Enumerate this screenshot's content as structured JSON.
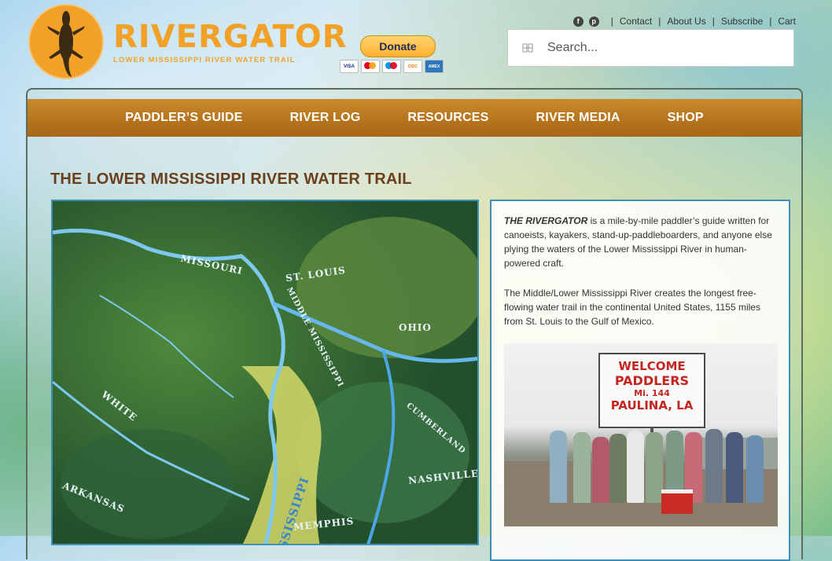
{
  "brand": {
    "name": "RIVERGATOR",
    "tagline": "LOWER MISSISSIPPI RIVER WATER TRAIL",
    "accent": "#f2a128"
  },
  "donate": {
    "label": "Donate",
    "cards": [
      "VISA",
      "MC",
      "MAESTRO",
      "DISCOVER",
      "AMEX"
    ]
  },
  "top_links": {
    "social": [
      "facebook-icon",
      "pinterest-icon"
    ],
    "items": [
      "Contact",
      "About Us",
      "Subscribe",
      "Cart"
    ]
  },
  "search": {
    "placeholder": "Search..."
  },
  "nav": {
    "items": [
      "PADDLER’S GUIDE",
      "RIVER LOG",
      "RESOURCES",
      "RIVER MEDIA",
      "SHOP"
    ],
    "color": "#b5731c"
  },
  "page": {
    "title": "THE LOWER MISSISSIPPI RIVER WATER TRAIL",
    "title_color": "#6b3f1c"
  },
  "map": {
    "labels": [
      "MISSOURI",
      "ST. LOUIS",
      "MIDDLE MISSISSIPPI",
      "OHIO",
      "CUMBERLAND",
      "NASHVILLE",
      "WHITE",
      "ARKANSAS",
      "MISSISSIPPI",
      "MEMPHIS"
    ]
  },
  "intro": {
    "lead": "THE RIVERGATOR",
    "para1": " is a mile-by-mile paddler’s guide written for canoeists, kayakers, stand-up-paddleboarders, and anyone else plying the waters of the Lower Mississippi River in human-powered craft.",
    "para2": "The Middle/Lower Mississippi River creates the longest free-flowing water trail in the continental United States, 1155 miles from St. Louis to the Gulf of Mexico."
  },
  "photo": {
    "sign_lines": [
      "WELCOME",
      "PADDLERS",
      "Mi. 144",
      "PAULINA, LA"
    ]
  }
}
